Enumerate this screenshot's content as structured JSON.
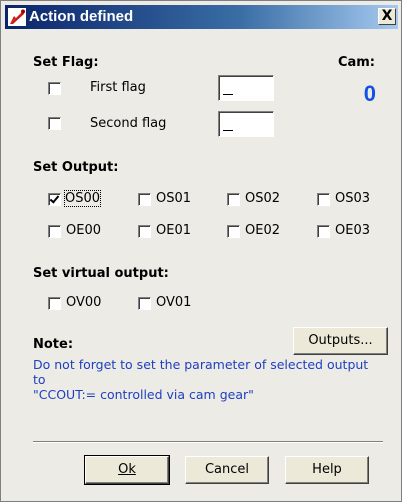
{
  "window": {
    "title": "Action defined",
    "close_label": "X"
  },
  "set_flag": {
    "heading": "Set Flag:",
    "first_flag_label": "First flag",
    "second_flag_label": "Second flag",
    "first_flag_checked": false,
    "second_flag_checked": false,
    "first_flag_value": "",
    "second_flag_value": ""
  },
  "cam": {
    "label": "Cam:",
    "value": "0",
    "value_color": "#1450e6"
  },
  "set_output": {
    "heading": "Set Output:",
    "row1": [
      {
        "label": "OS00",
        "checked": true
      },
      {
        "label": "OS01",
        "checked": false
      },
      {
        "label": "OS02",
        "checked": false
      },
      {
        "label": "OS03",
        "checked": false
      }
    ],
    "row2": [
      {
        "label": "OE00",
        "checked": false
      },
      {
        "label": "OE01",
        "checked": false
      },
      {
        "label": "OE02",
        "checked": false
      },
      {
        "label": "OE03",
        "checked": false
      }
    ]
  },
  "set_virtual_output": {
    "heading": "Set virtual output:",
    "items": [
      {
        "label": "OV00",
        "checked": false
      },
      {
        "label": "OV01",
        "checked": false
      }
    ]
  },
  "note": {
    "heading": "Note:",
    "text": "Do not forget to set the parameter of selected output to\n\"CCOUT:= controlled via cam gear\"",
    "text_color": "#1f3fbf"
  },
  "buttons": {
    "outputs": "Outputs...",
    "ok": "Ok",
    "cancel": "Cancel",
    "help": "Help"
  }
}
